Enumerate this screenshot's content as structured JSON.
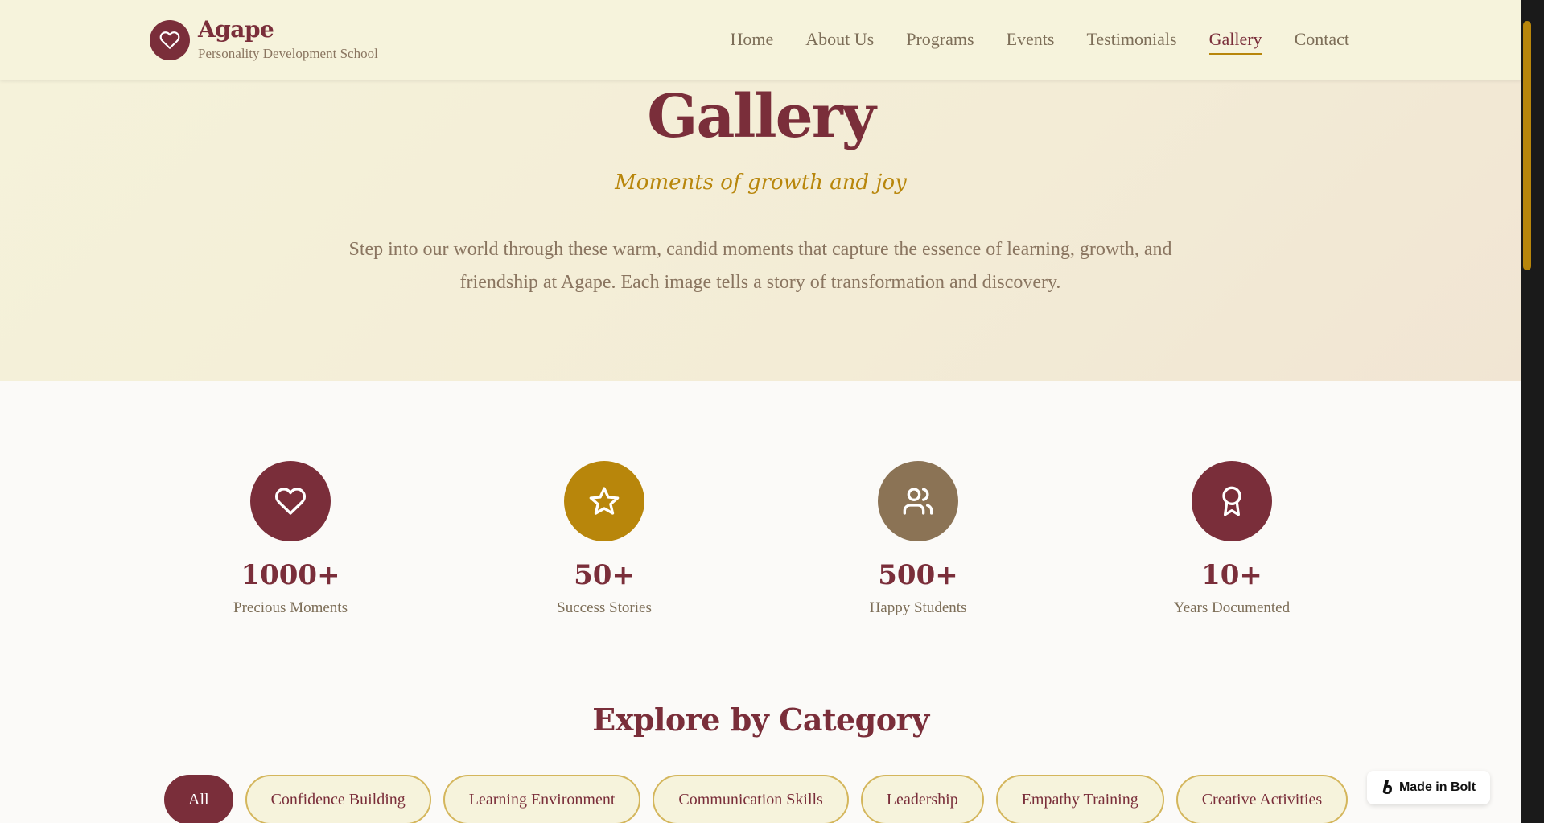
{
  "brand": {
    "name": "Agape",
    "subtitle": "Personality Development School",
    "icon": "heart-icon"
  },
  "nav": {
    "items": [
      {
        "label": "Home",
        "active": false
      },
      {
        "label": "About Us",
        "active": false
      },
      {
        "label": "Programs",
        "active": false
      },
      {
        "label": "Events",
        "active": false
      },
      {
        "label": "Testimonials",
        "active": false
      },
      {
        "label": "Gallery",
        "active": true
      },
      {
        "label": "Contact",
        "active": false
      }
    ]
  },
  "hero": {
    "title": "Gallery",
    "tagline": "Moments of growth and joy",
    "description": "Step into our world through these warm, candid moments that capture the essence of learning, growth, and friendship at Agape. Each image tells a story of transformation and discovery."
  },
  "stats": [
    {
      "value": "1000+",
      "label": "Precious Moments",
      "icon": "heart-icon",
      "color": "#7a2e3a"
    },
    {
      "value": "50+",
      "label": "Success Stories",
      "icon": "star-icon",
      "color": "#b8860b"
    },
    {
      "value": "500+",
      "label": "Happy Students",
      "icon": "users-icon",
      "color": "#8b7355"
    },
    {
      "value": "10+",
      "label": "Years Documented",
      "icon": "award-icon",
      "color": "#7a2e3a"
    }
  ],
  "explore": {
    "title": "Explore by Category",
    "categories": [
      {
        "label": "All",
        "active": true
      },
      {
        "label": "Confidence Building",
        "active": false
      },
      {
        "label": "Learning Environment",
        "active": false
      },
      {
        "label": "Communication Skills",
        "active": false
      },
      {
        "label": "Leadership",
        "active": false
      },
      {
        "label": "Empathy Training",
        "active": false
      },
      {
        "label": "Creative Activities",
        "active": false
      }
    ]
  },
  "badge": {
    "label": "Made in Bolt"
  },
  "colors": {
    "primary": "#7a2e3a",
    "gold": "#b8860b",
    "taupe": "#8b7355",
    "header_bg": "#f6f3dc"
  }
}
